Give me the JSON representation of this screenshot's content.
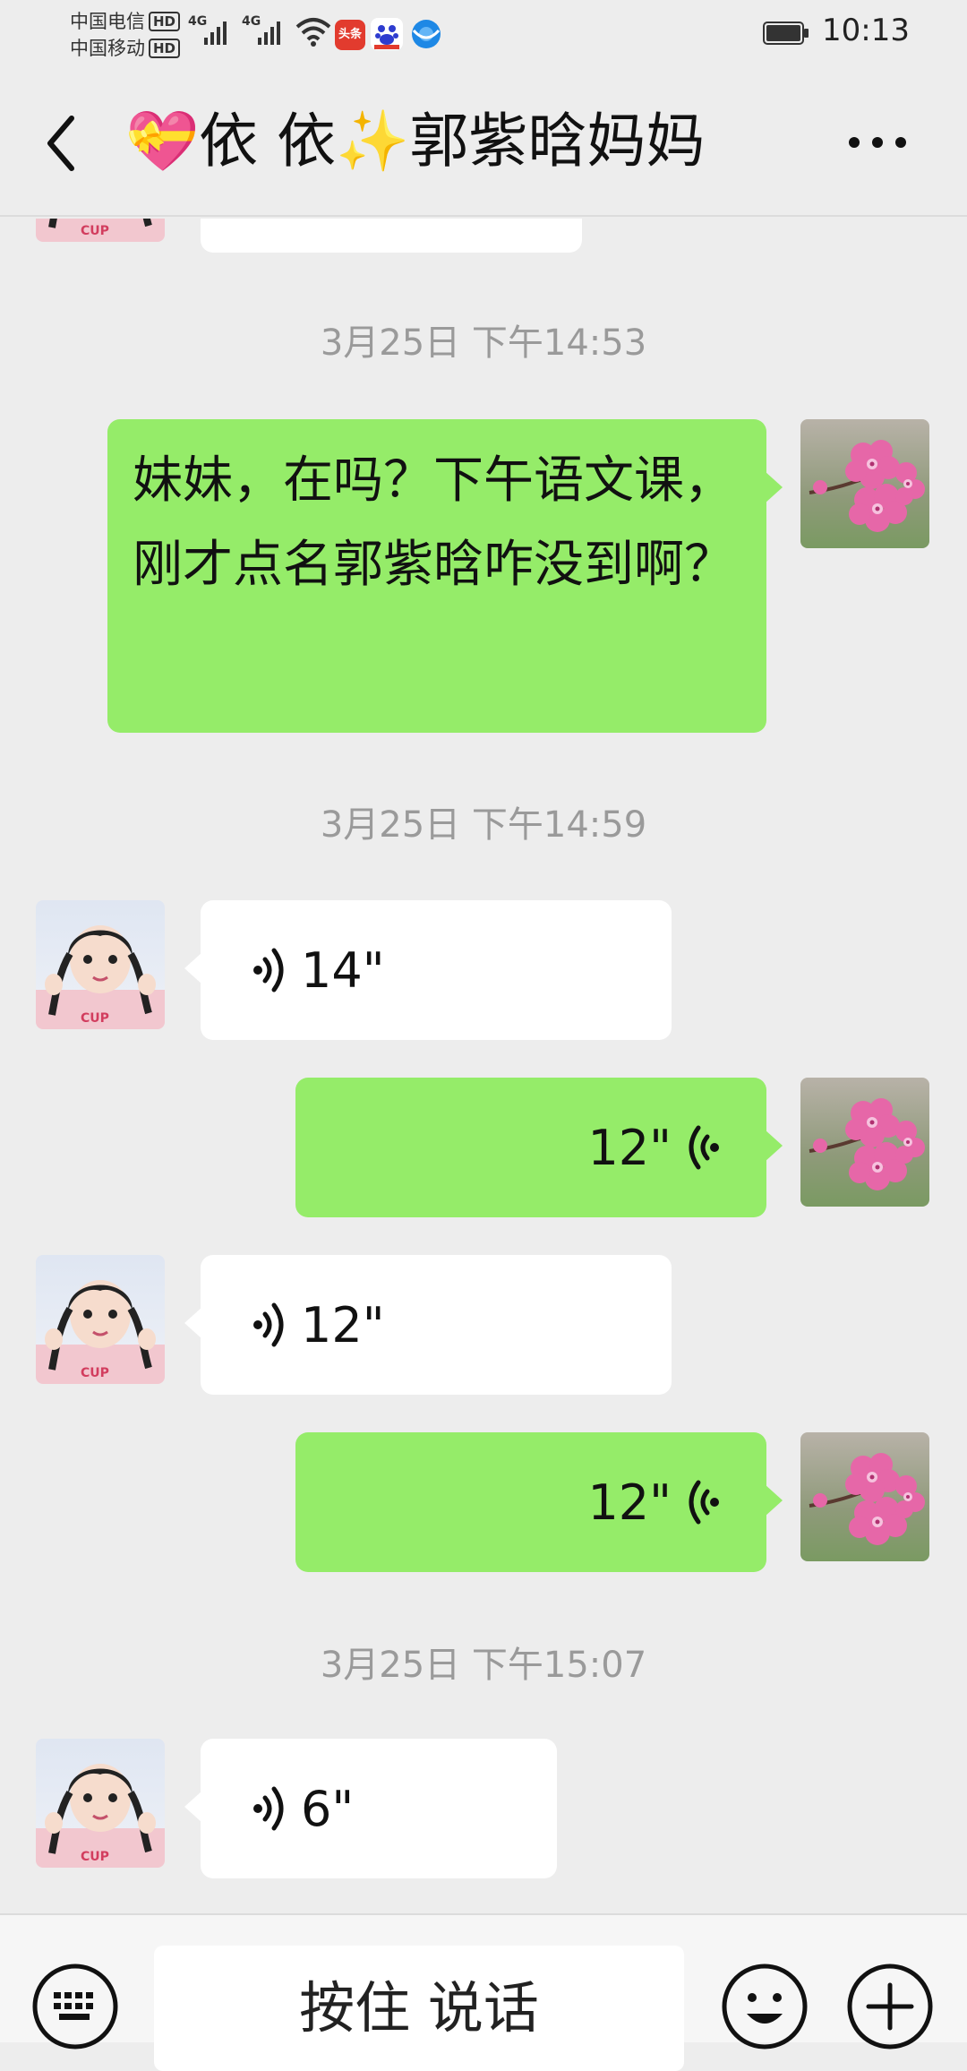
{
  "status_bar": {
    "carrier1": "中国电信",
    "carrier2": "中国移动",
    "hd": "HD",
    "network1": "4G",
    "network2": "4G",
    "app_badge1": "头条",
    "time": "10:13"
  },
  "header": {
    "title": "💝依 依✨郭紫晗妈妈",
    "back_icon": "chevron-left-icon",
    "more_icon": "more-dots-icon"
  },
  "timestamps": [
    "3月25日 下午14:53",
    "3月25日 下午14:59",
    "3月25日 下午15:07"
  ],
  "messages": [
    {
      "direction": "out",
      "type": "text",
      "text": "妹妹，在吗？下午语文课，刚才点名郭紫晗咋没到啊？"
    },
    {
      "direction": "in",
      "type": "voice",
      "duration": "14\""
    },
    {
      "direction": "out",
      "type": "voice",
      "duration": "12\""
    },
    {
      "direction": "in",
      "type": "voice",
      "duration": "12\""
    },
    {
      "direction": "out",
      "type": "voice",
      "duration": "12\""
    },
    {
      "direction": "in",
      "type": "voice",
      "duration": "6\""
    }
  ],
  "input_bar": {
    "hold_to_talk": "按住 说话",
    "keyboard_icon": "keyboard-icon",
    "emoji_icon": "emoji-icon",
    "plus_icon": "plus-icon"
  },
  "colors": {
    "background": "#ededed",
    "outgoing_bubble": "#95ec69",
    "incoming_bubble": "#ffffff",
    "timestamp_text": "#9a9a9a"
  }
}
